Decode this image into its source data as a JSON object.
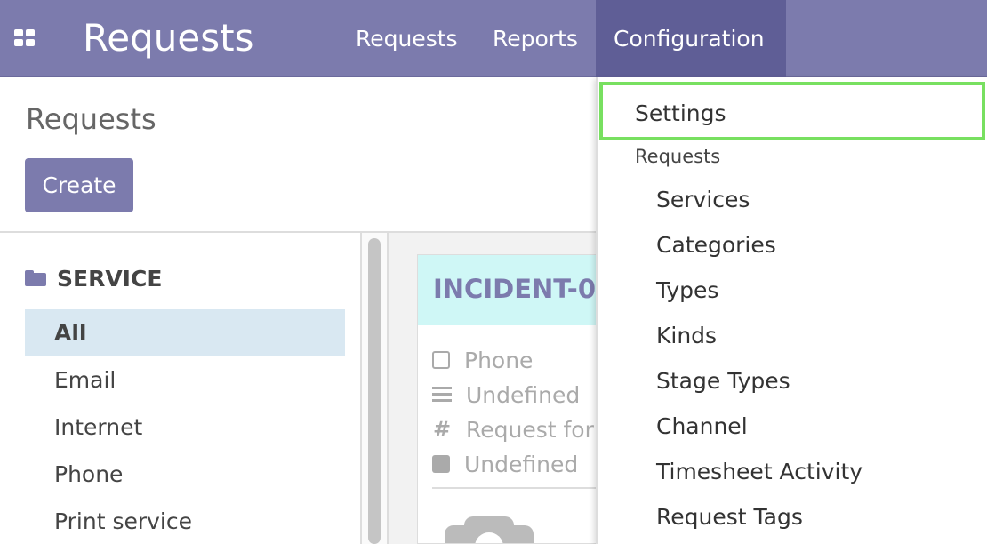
{
  "navbar": {
    "app_title": "Requests",
    "menu": [
      {
        "label": "Requests"
      },
      {
        "label": "Reports"
      },
      {
        "label": "Configuration"
      }
    ]
  },
  "control_panel": {
    "title": "Requests",
    "create_label": "Create"
  },
  "sidebar": {
    "header": "SERVICE",
    "items": [
      {
        "label": "All",
        "active": true
      },
      {
        "label": "Email"
      },
      {
        "label": "Internet"
      },
      {
        "label": "Phone"
      },
      {
        "label": "Print service"
      }
    ]
  },
  "card": {
    "title": "INCIDENT-0",
    "rows": [
      {
        "icon": "checkbox-icon",
        "text": "Phone"
      },
      {
        "icon": "bars-icon",
        "text": "Undefined"
      },
      {
        "icon": "hash-icon",
        "text": "Request for"
      },
      {
        "icon": "square-icon",
        "text": "Undefined"
      }
    ]
  },
  "dropdown": {
    "settings": "Settings",
    "section_header": "Requests",
    "items": [
      {
        "label": "Services"
      },
      {
        "label": "Categories"
      },
      {
        "label": "Types"
      },
      {
        "label": "Kinds"
      },
      {
        "label": "Stage Types"
      },
      {
        "label": "Channel"
      },
      {
        "label": "Timesheet Activity"
      },
      {
        "label": "Request Tags"
      }
    ]
  },
  "colors": {
    "brand": "#7c7bad",
    "highlight": "#78e060",
    "card_header": "#cff7f6",
    "sidebar_active": "#d9e8f2"
  }
}
